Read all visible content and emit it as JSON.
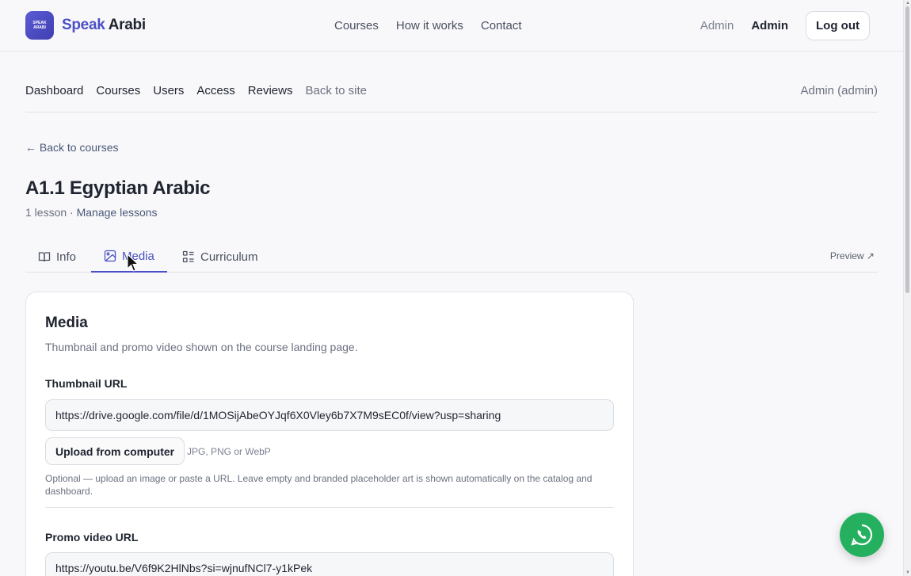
{
  "brand": {
    "part1": "Speak",
    "part2": "Arabi",
    "mark_line1": "SPEAK",
    "mark_line2": "ARABI"
  },
  "main_nav": [
    "Courses",
    "How it works",
    "Contact"
  ],
  "user": {
    "role": "Admin",
    "name": "Admin",
    "logout": "Log out"
  },
  "admin_nav": {
    "links": [
      "Dashboard",
      "Courses",
      "Users",
      "Access",
      "Reviews"
    ],
    "back_to_site": "Back to site",
    "current_user": "Admin (admin)"
  },
  "back_link": "← Back to courses",
  "course": {
    "title": "A1.1 Egyptian Arabic",
    "lessons": "1 lesson",
    "separator": "·",
    "manage": "Manage lessons"
  },
  "tabs": [
    {
      "label": "Info",
      "icon": "book-icon",
      "active": false
    },
    {
      "label": "Media",
      "icon": "image-icon",
      "active": true
    },
    {
      "label": "Curriculum",
      "icon": "list-icon",
      "active": false
    }
  ],
  "preview": "Preview ↗",
  "media": {
    "title": "Media",
    "description": "Thumbnail and promo video shown on the course landing page.",
    "thumbnail": {
      "label": "Thumbnail URL",
      "value": "https://drive.google.com/file/d/1MOSijAbeOYJqf6X0Vley6b7X7M9sEC0f/view?usp=sharing",
      "upload_label": "Upload from computer",
      "formats": "JPG, PNG or WebP",
      "hint": "Optional — upload an image or paste a URL. Leave empty and branded placeholder art is shown automatically on the catalog and dashboard."
    },
    "promo": {
      "label": "Promo video URL",
      "value": "https://youtu.be/V6f9K2HlNbs?si=wjnufNCl7-y1kPek"
    }
  },
  "colors": {
    "accent": "#4b4fc4",
    "whatsapp": "#25b060"
  }
}
